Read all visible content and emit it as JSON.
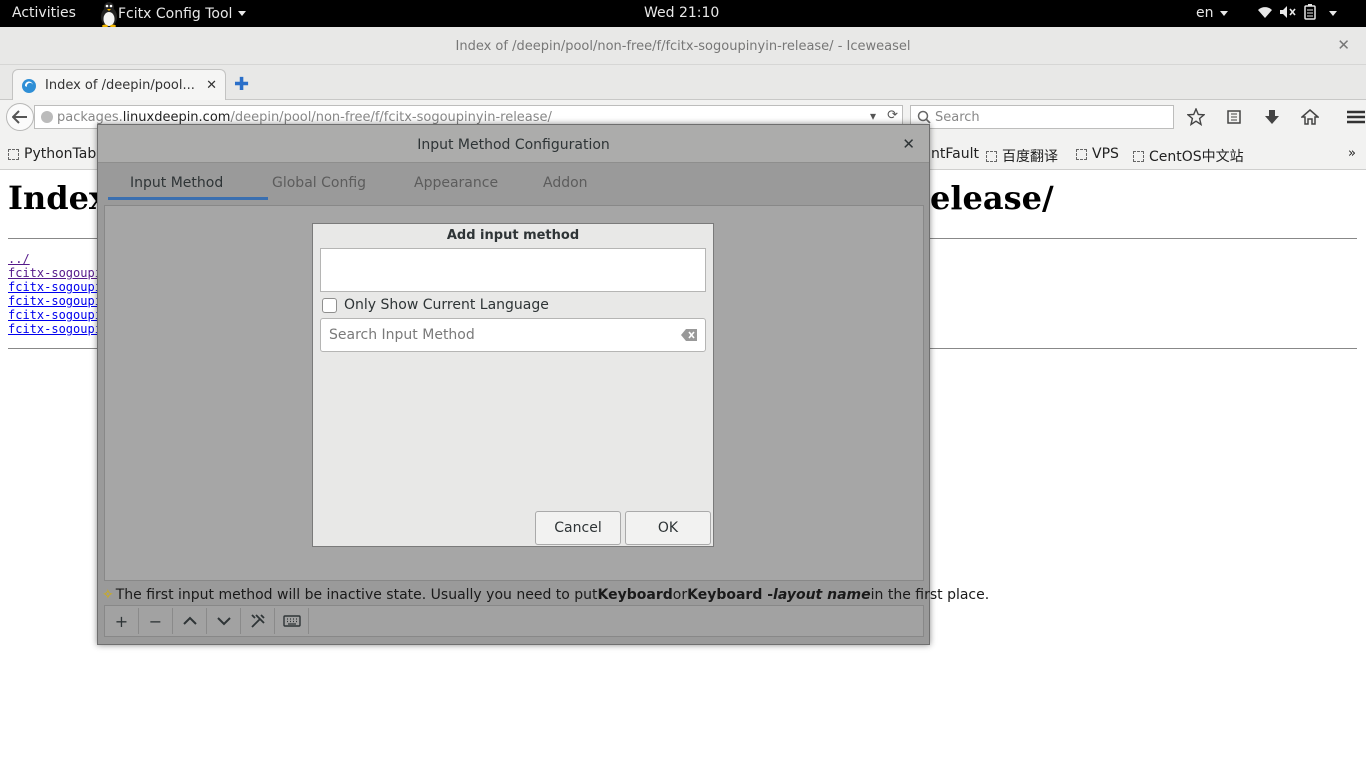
{
  "topbar": {
    "activities": "Activities",
    "app_menu": "Fcitx Config Tool",
    "clock": "Wed 21:10",
    "lang": "en"
  },
  "browser": {
    "window_title": "Index of /deepin/pool/non-free/f/fcitx-sogoupinyin-release/ - Iceweasel",
    "tab_label": "Index of /deepin/pool...",
    "url_prefix": "packages.",
    "url_host": "linuxdeepin.com",
    "url_path": "/deepin/pool/non-free/f/fcitx-sogoupinyin-release/",
    "search_placeholder": "Search",
    "bookmarks": [
      "PythonTab",
      "ntFault",
      "百度翻译",
      "VPS",
      "CentOS中文站"
    ]
  },
  "page": {
    "heading": "Index",
    "heading_tail": "elease/",
    "links": [
      "../",
      "fcitx-sogoupi",
      "fcitx-sogoupi",
      "fcitx-sogoupi",
      "fcitx-sogoupi",
      "fcitx-sogoupi"
    ]
  },
  "fcitx": {
    "title": "Input Method Configuration",
    "tabs": [
      "Input Method",
      "Global Config",
      "Appearance",
      "Addon"
    ],
    "hint_pre": "The first input method will be inactive state. Usually you need to put ",
    "hint_kb": "Keyboard",
    "hint_or": " or ",
    "hint_kb2": "Keyboard - ",
    "hint_layout": "layout name",
    "hint_post": " in the first place."
  },
  "dialog": {
    "title": "Add input method",
    "checkbox_label": "Only Show Current Language",
    "search_placeholder": "Search Input Method",
    "cancel": "Cancel",
    "ok": "OK"
  }
}
